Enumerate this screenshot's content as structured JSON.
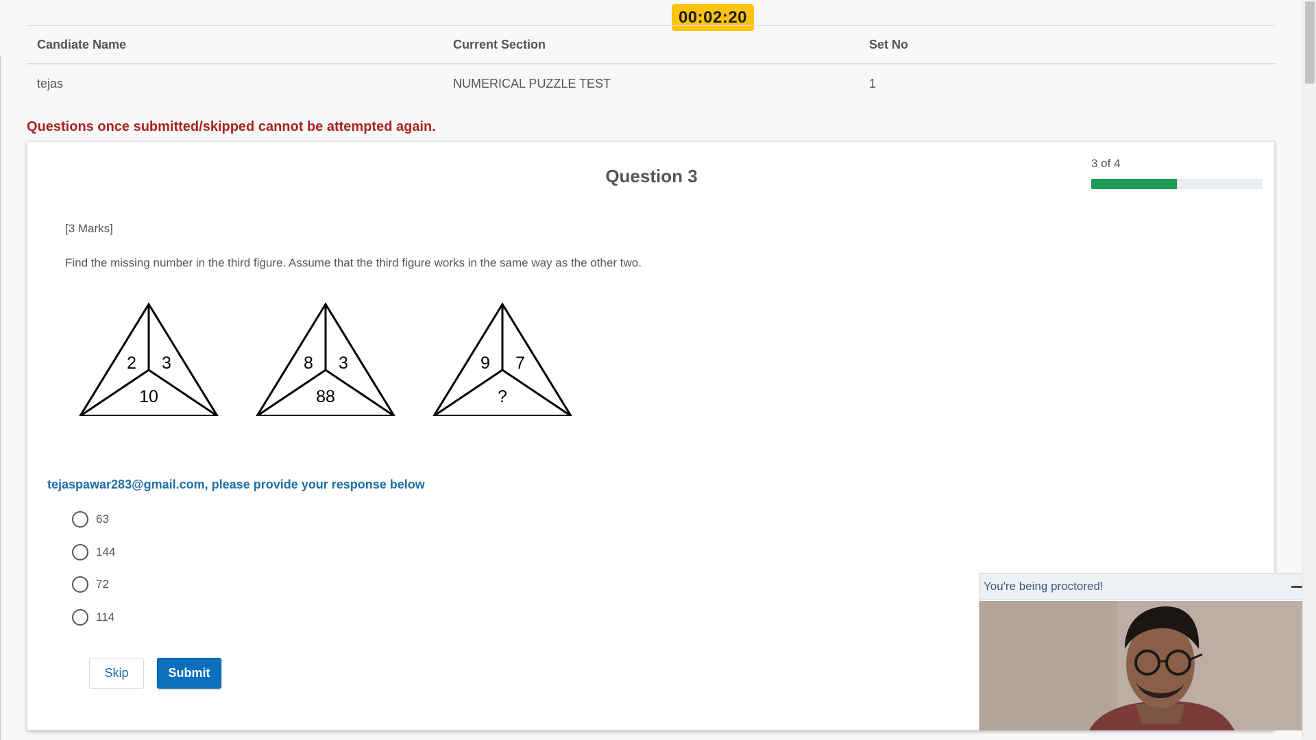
{
  "timer": "00:02:20",
  "info": {
    "headers": [
      "Candiate Name",
      "Current Section",
      "Set No"
    ],
    "values": [
      "tejas",
      "NUMERICAL PUZZLE TEST",
      "1"
    ]
  },
  "warning": "Questions once submitted/skipped cannot be attempted again.",
  "question": {
    "title": "Question 3",
    "progress_text": "3 of 4",
    "progress_fraction": 0.5,
    "marks": "[3 Marks]",
    "text": "Find the missing number in the third figure. Assume that the third figure works in the same way as the other two.",
    "figures": [
      {
        "left": "2",
        "right": "3",
        "bottom": "10"
      },
      {
        "left": "8",
        "right": "3",
        "bottom": "88"
      },
      {
        "left": "9",
        "right": "7",
        "bottom": "?"
      }
    ]
  },
  "response": {
    "prompt": "tejaspawar283@gmail.com, please provide your response below",
    "options": [
      "63",
      "144",
      "72",
      "114"
    ]
  },
  "buttons": {
    "skip": "Skip",
    "submit": "Submit"
  },
  "proctor": {
    "title": "You're being proctored!"
  },
  "colors": {
    "timer_bg": "#ffc20e",
    "warning": "#a82222",
    "progress": "#1e9b5a",
    "prompt": "#1f6fa6",
    "submit_bg": "#0b6fbd"
  }
}
